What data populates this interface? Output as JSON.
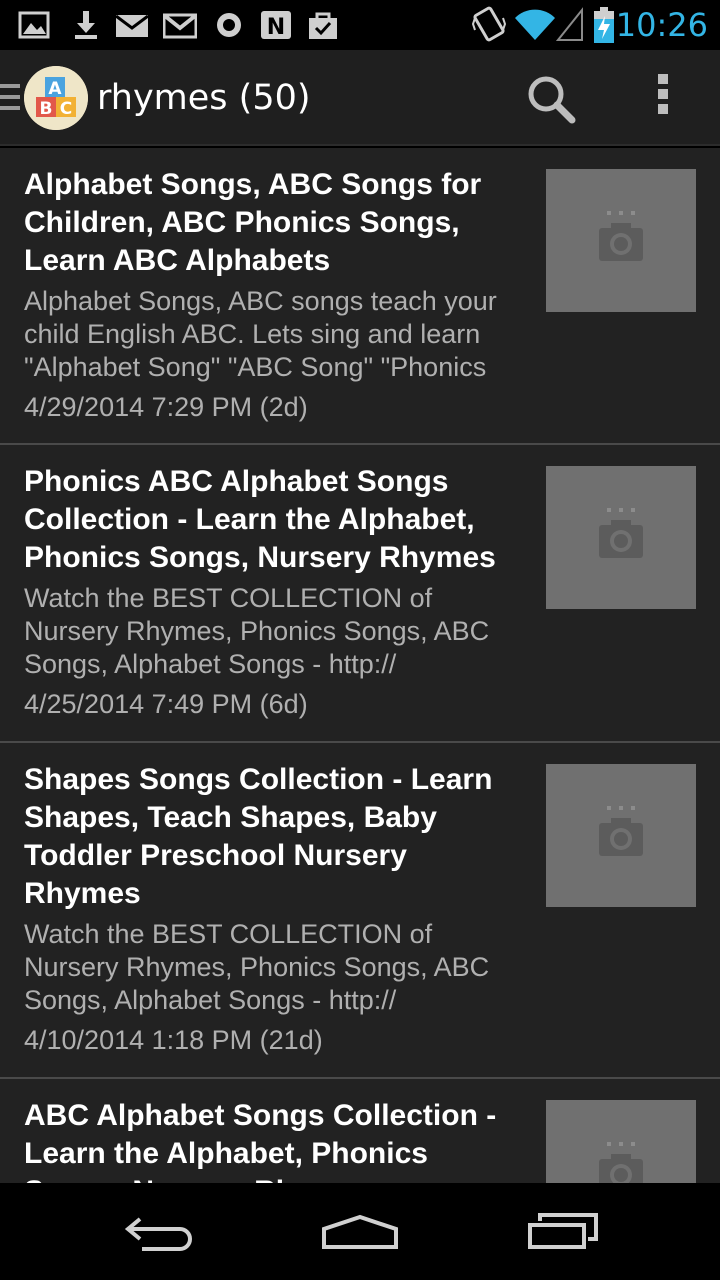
{
  "status_bar": {
    "time": "10:26",
    "left_icons": [
      "gallery-icon",
      "download-icon",
      "email-icon",
      "gmail-icon",
      "record-icon",
      "news-icon",
      "shopping-bag-icon"
    ],
    "right_icons": [
      "vibrate-icon",
      "wifi-icon",
      "signal-icon",
      "battery-charging-icon"
    ],
    "accent_color": "#33b5e5"
  },
  "action_bar": {
    "title": "rhymes (50)",
    "logo_letters": [
      "A",
      "B",
      "C"
    ]
  },
  "items": [
    {
      "title": "Alphabet Songs, ABC Songs for Children, ABC Phonics Songs, Learn ABC Alphabets",
      "description": "Alphabet Songs, ABC songs teach your child English ABC. Lets sing and learn \"Alphabet Song\" \"ABC Song\" \"Phonics",
      "date": "4/29/2014 7:29 PM (2d)"
    },
    {
      "title": "Phonics ABC Alphabet Songs Collection - Learn the Alphabet, Phonics Songs, Nursery Rhymes",
      "description": "Watch the BEST COLLECTION of Nursery Rhymes, Phonics Songs, ABC Songs, Alphabet Songs - http://",
      "date": "4/25/2014 7:49 PM (6d)"
    },
    {
      "title": "Shapes Songs Collection - Learn Shapes, Teach Shapes, Baby Toddler Preschool Nursery Rhymes",
      "description": "Watch the BEST COLLECTION of Nursery Rhymes, Phonics Songs, ABC Songs, Alphabet Songs - http://",
      "date": "4/10/2014 1:18 PM (21d)"
    },
    {
      "title": "ABC Alphabet Songs Collection - Learn the Alphabet, Phonics Songs, Nursery Rhymes",
      "description": "",
      "date": ""
    }
  ]
}
